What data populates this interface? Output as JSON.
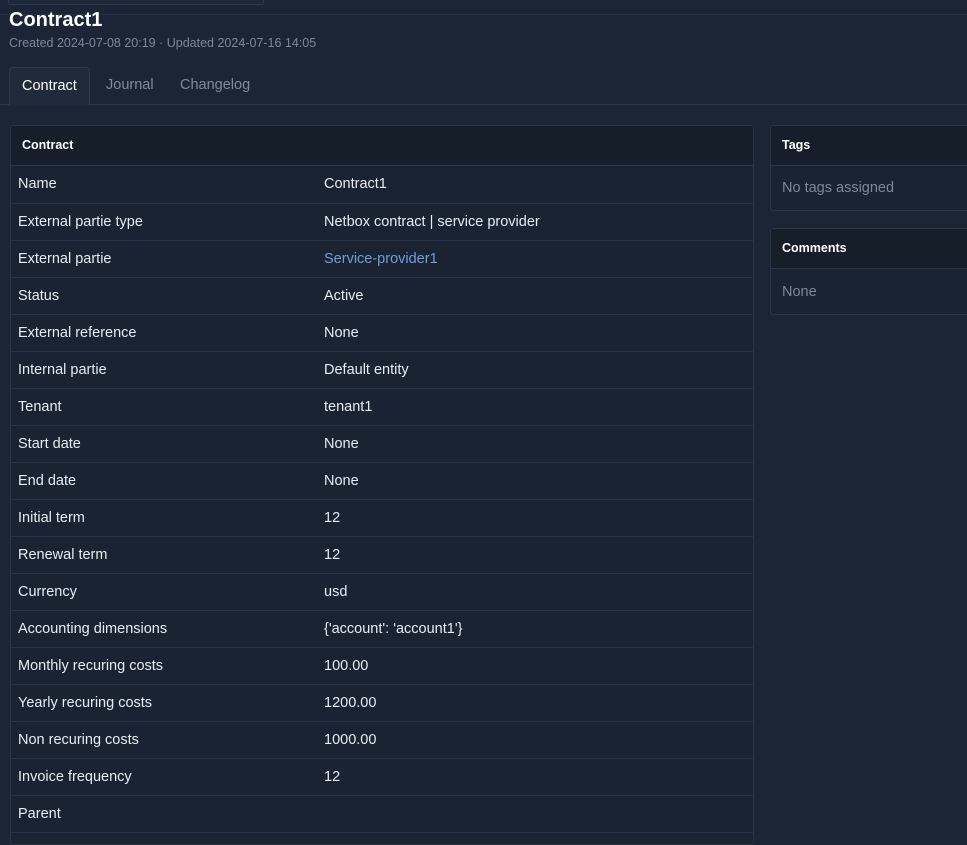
{
  "page": {
    "title": "Contract1",
    "subtitle": "Created 2024-07-08 20:19 · Updated 2024-07-16 14:05"
  },
  "tabs": [
    {
      "label": "Contract",
      "active": true
    },
    {
      "label": "Journal",
      "active": false
    },
    {
      "label": "Changelog",
      "active": false
    }
  ],
  "contract_card": {
    "header": "Contract",
    "rows": [
      {
        "key": "Name",
        "value": "Contract1"
      },
      {
        "key": "External partie type",
        "value": "Netbox contract | service provider"
      },
      {
        "key": "External partie",
        "value": "Service-provider1",
        "link": true
      },
      {
        "key": "Status",
        "value": "Active"
      },
      {
        "key": "External reference",
        "value": "None"
      },
      {
        "key": "Internal partie",
        "value": "Default entity"
      },
      {
        "key": "Tenant",
        "value": "tenant1"
      },
      {
        "key": "Start date",
        "value": "None"
      },
      {
        "key": "End date",
        "value": "None"
      },
      {
        "key": "Initial term",
        "value": "12"
      },
      {
        "key": "Renewal term",
        "value": "12"
      },
      {
        "key": "Currency",
        "value": "usd"
      },
      {
        "key": "Accounting dimensions",
        "value": "{'account': 'account1'}"
      },
      {
        "key": "Monthly recuring costs",
        "value": "100.00"
      },
      {
        "key": "Yearly recuring costs",
        "value": "1200.00"
      },
      {
        "key": "Non recuring costs",
        "value": "1000.00"
      },
      {
        "key": "Invoice frequency",
        "value": "12"
      },
      {
        "key": "Parent",
        "value": ""
      }
    ]
  },
  "tags_card": {
    "header": "Tags",
    "empty_text": "No tags assigned"
  },
  "comments_card": {
    "header": "Comments",
    "empty_text": "None"
  },
  "colors": {
    "background": "#1b2535",
    "card": "#1a2331",
    "card_header": "#161e2a",
    "link": "#6f9fd8",
    "muted": "#7c8799"
  }
}
